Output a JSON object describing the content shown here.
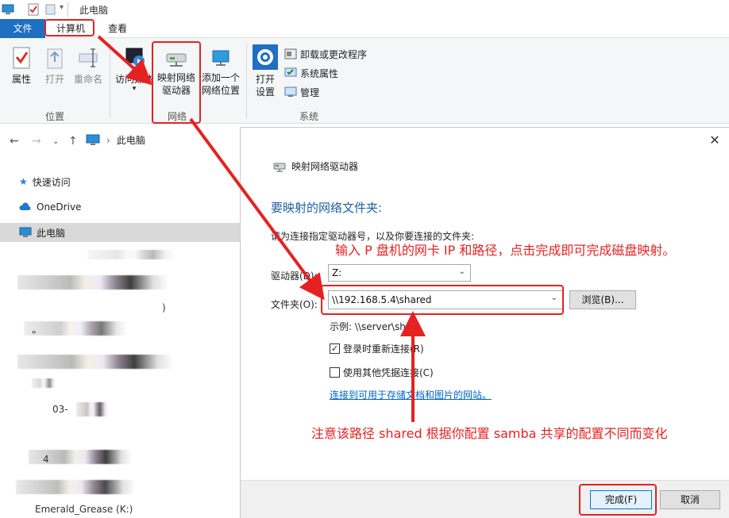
{
  "titlebar": {
    "title": "此电脑"
  },
  "ribbon": {
    "tabs": {
      "file": "文件",
      "computer": "计算机",
      "view": "查看"
    },
    "location_group": {
      "label": "位置",
      "properties": "属性",
      "open": "打开",
      "rename": "重命名"
    },
    "network_group": {
      "label": "网络",
      "access_media": "访问媒体",
      "map_drive_line1": "映射网络",
      "map_drive_line2": "驱动器",
      "add_location_line1": "添加一个",
      "add_location_line2": "网络位置"
    },
    "system_group": {
      "label": "系统",
      "open_settings_line1": "打开",
      "open_settings_line2": "设置",
      "uninstall": "卸载或更改程序",
      "system_properties": "系统属性",
      "manage": "管理"
    }
  },
  "address": {
    "crumb": "此电脑"
  },
  "navpane": {
    "quick_access": "快速访问",
    "onedrive": "OneDrive",
    "this_pc": "此电脑",
    "fragments": [
      ")",
      "\"",
      "03-",
      "4",
      ".4",
      "4",
      "Emerald_Grease (K:)"
    ]
  },
  "dialog": {
    "title": "映射网络驱动器",
    "heading": "要映射的网络文件夹:",
    "instruction": "请为连接指定驱动器号，以及你要连接的文件夹:",
    "drive_label": "驱动器(D):",
    "drive_value": "Z:",
    "folder_label": "文件夹(O):",
    "folder_value": "\\\\192.168.5.4\\shared",
    "browse": "浏览(B)...",
    "example": "示例: \\\\server\\share",
    "reconnect": "登录时重新连接(R)",
    "reconnect_checked": true,
    "other_creds": "使用其他凭据连接(C)",
    "other_creds_checked": false,
    "link": "连接到可用于存储文档和图片的网站。",
    "finish": "完成(F)",
    "cancel": "取消"
  },
  "annotations": {
    "top_note": "输入 P 盘机的网卡 IP 和路径，点击完成即可完成磁盘映射。",
    "bottom_note": "注意该路径 shared 根据你配置 samba 共享的配置不同而变化",
    "color": "#e52222"
  }
}
